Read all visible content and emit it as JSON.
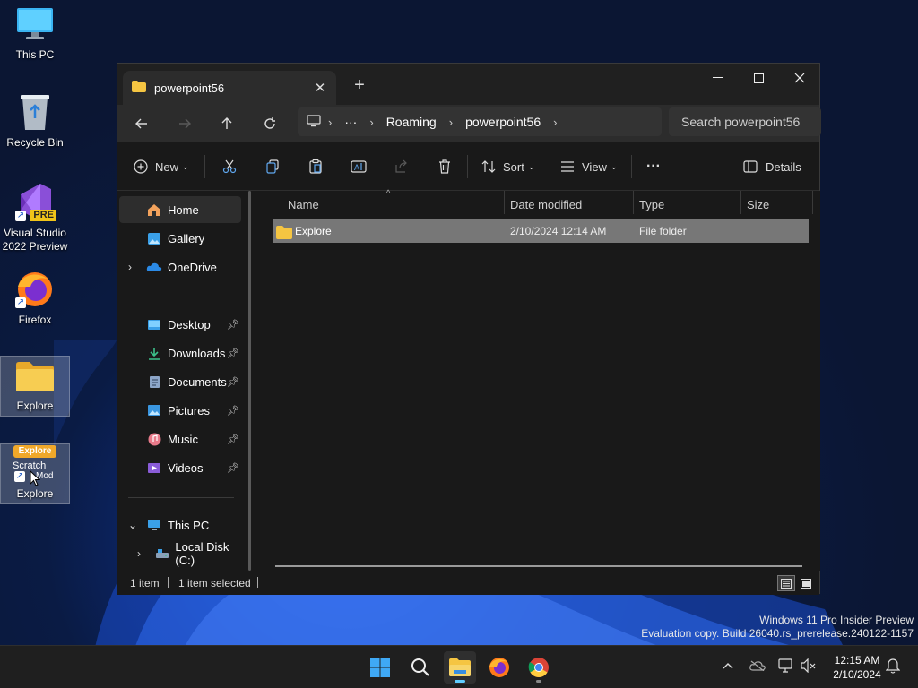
{
  "desktop": {
    "icons": [
      {
        "label": "This PC"
      },
      {
        "label": "Recycle Bin"
      },
      {
        "label": "Visual Studio 2022 Preview",
        "badge": "PRE"
      },
      {
        "label": "Firefox"
      },
      {
        "label": "Explore"
      },
      {
        "label": "Explore",
        "img_text_top": "Explore",
        "img_text_mid": "Scratch",
        "img_text_mod": "Mod"
      }
    ]
  },
  "window": {
    "tab_title": "powerpoint56",
    "new_tab": "+",
    "address": {
      "more": "···",
      "crumbs": [
        "Roaming",
        "powerpoint56"
      ]
    },
    "search_placeholder": "Search powerpoint56",
    "toolbar": {
      "new_label": "New",
      "sort_label": "Sort",
      "view_label": "View",
      "more": "···",
      "details_label": "Details"
    },
    "sidebar": {
      "home": "Home",
      "gallery": "Gallery",
      "onedrive": "OneDrive",
      "desktop": "Desktop",
      "downloads": "Downloads",
      "documents": "Documents",
      "pictures": "Pictures",
      "music": "Music",
      "videos": "Videos",
      "thispc": "This PC",
      "localdisk": "Local Disk (C:)"
    },
    "columns": {
      "name": "Name",
      "date": "Date modified",
      "type": "Type",
      "size": "Size"
    },
    "rows": [
      {
        "name": "Explore",
        "date": "2/10/2024 12:14 AM",
        "type": "File folder",
        "size": ""
      }
    ],
    "status": {
      "count": "1 item",
      "selected": "1 item selected"
    }
  },
  "watermark": {
    "line1": "Windows 11 Pro Insider Preview",
    "line2": "Evaluation copy. Build 26040.rs_prerelease.240122-1157"
  },
  "clock": {
    "time": "12:15 AM",
    "date": "2/10/2024"
  },
  "colors": {
    "accent": "#60cdff",
    "folder": "#f5c542",
    "selection": "#777777"
  }
}
